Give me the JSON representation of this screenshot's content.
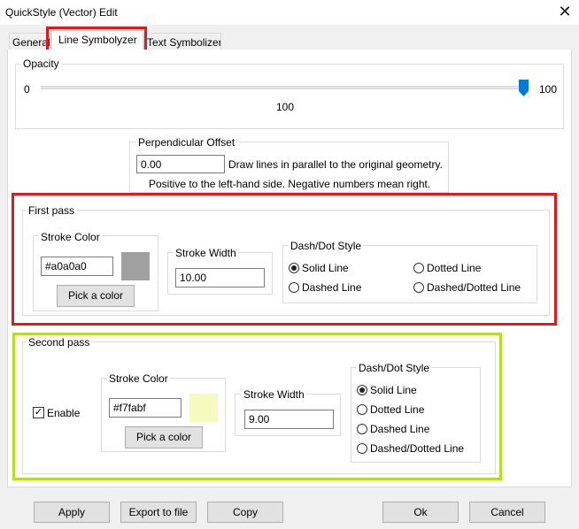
{
  "window": {
    "title": "QuickStyle (Vector) Edit",
    "close_glyph": "✕"
  },
  "tabs": [
    {
      "label": "General"
    },
    {
      "label": "Line Symbolyzer"
    },
    {
      "label": "Text Symbolizer"
    }
  ],
  "opacity": {
    "label": "Opacity",
    "min_label": "0",
    "max_label": "100",
    "value_label": "100",
    "value": 100
  },
  "offset": {
    "label": "Perpendicular Offset",
    "value": "0.00",
    "hint1": "Draw lines in parallel to the original geometry.",
    "hint2": "Positive to the left-hand side. Negative numbers mean right."
  },
  "first_pass": {
    "label": "First pass",
    "stroke_color_label": "Stroke Color",
    "color_value": "#a0a0a0",
    "swatch_color": "#a0a0a0",
    "pick_label": "Pick a color",
    "stroke_width_label": "Stroke Width",
    "width_value": "10.00",
    "dash_label": "Dash/Dot Style",
    "styles": [
      "Solid Line",
      "Dotted Line",
      "Dashed Line",
      "Dashed/Dotted Line"
    ],
    "selected_style": "Solid Line"
  },
  "second_pass": {
    "label": "Second pass",
    "enable_label": "Enable",
    "enabled": true,
    "stroke_color_label": "Stroke Color",
    "color_value": "#f7fabf",
    "swatch_color": "#f7fabf",
    "pick_label": "Pick a color",
    "stroke_width_label": "Stroke Width",
    "width_value": "9.00",
    "dash_label": "Dash/Dot Style",
    "styles": [
      "Solid Line",
      "Dotted Line",
      "Dashed Line",
      "Dashed/Dotted Line"
    ],
    "selected_style": "Solid Line"
  },
  "footer": {
    "apply": "Apply",
    "export": "Export to file",
    "copy": "Copy",
    "ok": "Ok",
    "cancel": "Cancel"
  },
  "colors": {
    "highlight_red": "#e0191f",
    "highlight_green": "#b3de22",
    "slider_thumb": "#0078d7"
  }
}
